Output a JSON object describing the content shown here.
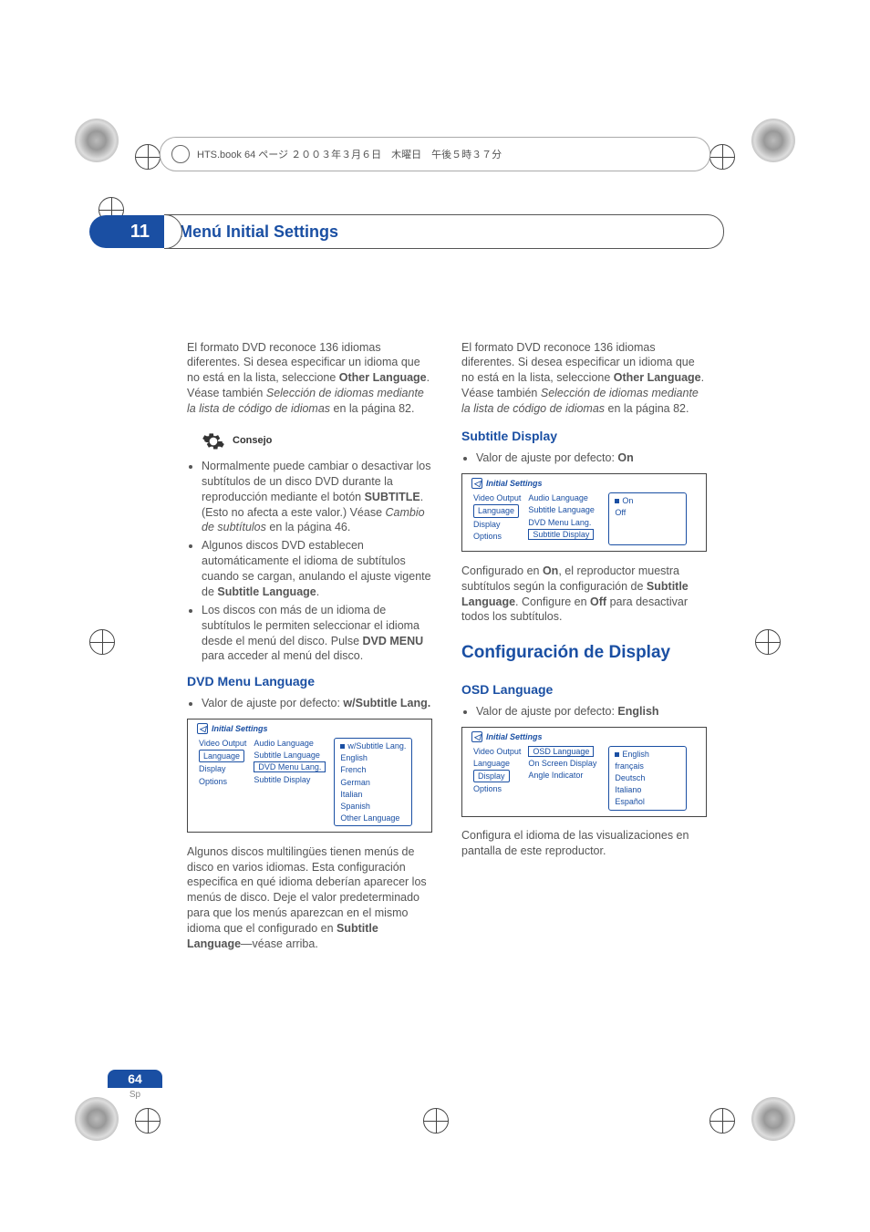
{
  "book_header": "HTS.book 64 ページ ２００３年３月６日　木曜日　午後５時３７分",
  "chapter": {
    "number": "11",
    "title": "Menú Initial Settings"
  },
  "page": {
    "num": "64",
    "lang": "Sp"
  },
  "col_left": {
    "intro_p1a": "El formato DVD reconoce 136 idiomas diferentes. Si desea especificar un idioma que no está en la lista, seleccione ",
    "intro_bold1": "Other Language",
    "intro_p1b": ". Véase también ",
    "intro_it1": "Selección de idiomas mediante la lista de código de idiomas",
    "intro_p1c": " en la página 82.",
    "tip_label": "Consejo",
    "tip1a": "Normalmente puede cambiar o desactivar los subtítulos de un disco DVD durante la reproducción mediante el botón ",
    "tip1b": "SUBTITLE",
    "tip1c": ". (Esto no afecta a este valor.) Véase ",
    "tip1d": "Cambio de subtítulos",
    "tip1e": " en la página 46.",
    "tip2a": "Algunos discos DVD establecen automáticamente el idioma de subtítulos cuando se cargan, anulando el ajuste vigente de ",
    "tip2b": "Subtitle Language",
    "tip2c": ".",
    "tip3a": "Los discos con más de un idioma de subtítulos le permiten seleccionar el idioma desde el menú del disco. Pulse ",
    "tip3b": "DVD MENU",
    "tip3c": " para acceder al menú del disco.",
    "dvd_menu_hd": "DVD Menu Language",
    "dvd_menu_def_a": "Valor de ajuste por defecto: ",
    "dvd_menu_def_b": "w/Subtitle Lang.",
    "para2a": "Algunos discos multilingües tienen menús de disco en varios idiomas. Esta configuración especifica en qué idioma deberían aparecer los menús de disco. Deje el valor predeterminado para que los menús aparezcan en el mismo idioma que el configurado en ",
    "para2b": "Subtitle Language",
    "para2c": "—véase arriba."
  },
  "col_right": {
    "intro_p1a": "El formato DVD reconoce 136 idiomas diferentes. Si desea especificar un idioma que no está en la lista, seleccione ",
    "intro_bold1": "Other Language",
    "intro_p1b": ". Véase también ",
    "intro_it1": "Selección de idiomas mediante la lista de código de idiomas",
    "intro_p1c": " en la página 82.",
    "subtitle_hd": "Subtitle Display",
    "subtitle_def_a": "Valor de ajuste por defecto: ",
    "subtitle_def_b": "On",
    "conf_a": "Configurado en ",
    "conf_b": "On",
    "conf_c": ", el reproductor muestra subtítulos según la configuración de ",
    "conf_d": "Subtitle Language",
    "conf_e": ". Configure en ",
    "conf_f": "Off",
    "conf_g": " para desactivar todos los subtítulos.",
    "disp_hd": "Configuración de Display",
    "osd_hd": "OSD Language",
    "osd_def_a": "Valor de ajuste por defecto: ",
    "osd_def_b": "English",
    "osd_after": "Configura el idioma de las visualizaciones en pantalla de este reproductor."
  },
  "mini1": {
    "title": "Initial Settings",
    "left": [
      "Video Output",
      "Language",
      "Display",
      "Options"
    ],
    "mid": [
      "Audio Language",
      "Subtitle Language",
      "DVD Menu Lang.",
      "Subtitle Display"
    ],
    "right": [
      "w/Subtitle Lang.",
      "English",
      "French",
      "German",
      "Italian",
      "Spanish",
      "Other Language"
    ]
  },
  "mini2": {
    "title": "Initial Settings",
    "left": [
      "Video Output",
      "Language",
      "Display",
      "Options"
    ],
    "mid": [
      "Audio Language",
      "Subtitle Language",
      "DVD Menu Lang.",
      "Subtitle Display"
    ],
    "right": [
      "On",
      "Off"
    ]
  },
  "mini3": {
    "title": "Initial Settings",
    "left": [
      "Video Output",
      "Language",
      "Display",
      "Options"
    ],
    "mid": [
      "OSD Language",
      "On Screen Display",
      "Angle Indicator"
    ],
    "right": [
      "English",
      "français",
      "Deutsch",
      "Italiano",
      "Español"
    ]
  }
}
